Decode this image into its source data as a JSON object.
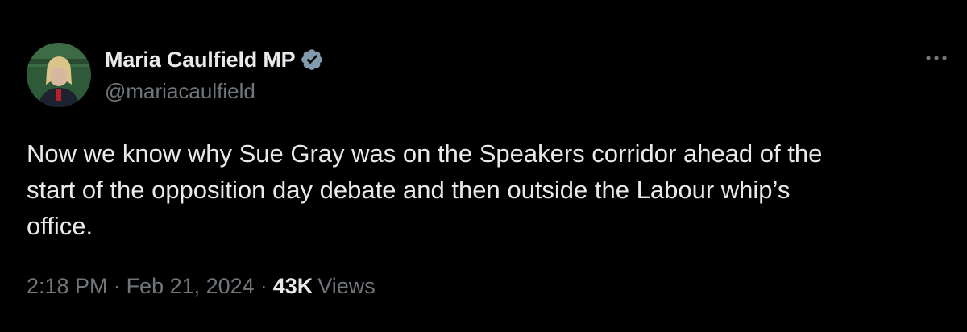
{
  "author": {
    "display_name": "Maria Caulfield MP",
    "handle": "@mariacaulfield",
    "verified": true,
    "verified_color": "#829aab"
  },
  "tweet": {
    "text": "Now we know why Sue Gray was on the Speakers corridor ahead of the\nstart of the opposition day debate and then outside the Labour whip’s\noffice."
  },
  "meta": {
    "time": "2:18 PM",
    "separator": "·",
    "date": "Feb 21, 2024",
    "views_count": "43K",
    "views_label": "Views"
  },
  "icons": {
    "more": "more-horizontal-icon",
    "verified": "verified-badge-icon"
  },
  "colors": {
    "background": "#000000",
    "primary_text": "#e7e9ea",
    "secondary_text": "#71767b"
  }
}
